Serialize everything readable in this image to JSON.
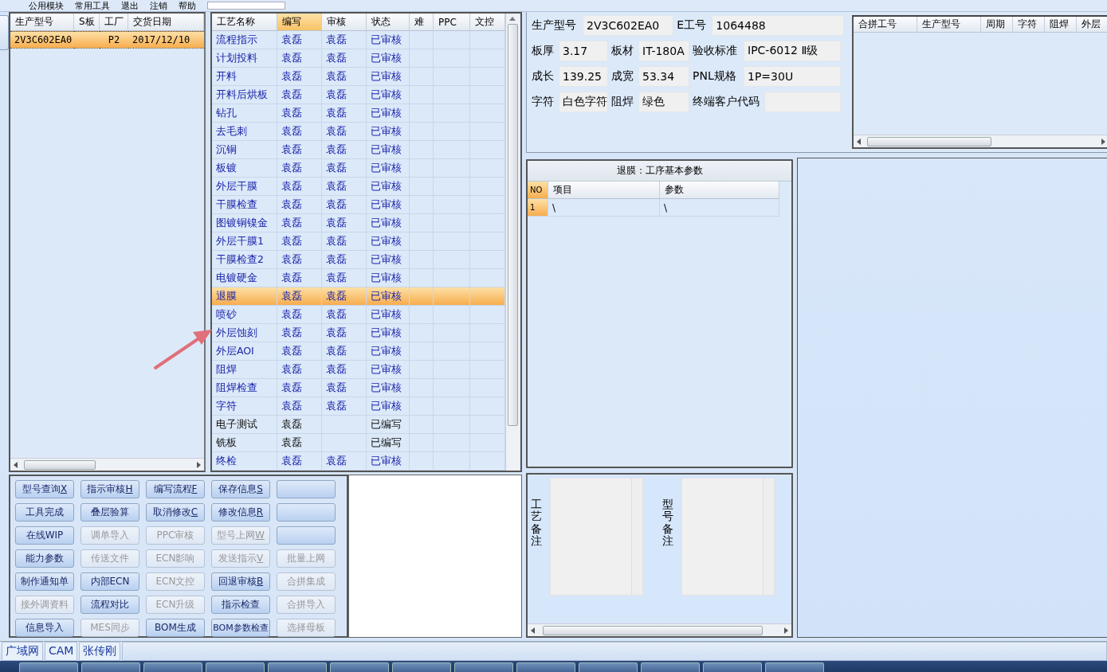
{
  "menu": [
    {
      "label": "公用模块"
    },
    {
      "label": "常用工具"
    },
    {
      "label": "退出"
    },
    {
      "label": "注销"
    },
    {
      "label": "帮助"
    }
  ],
  "order_grid": {
    "columns": [
      "生产型号",
      "S板",
      "工厂",
      "交货日期"
    ],
    "rows": [
      {
        "model": "2V3C602EA0",
        "factory": "P2",
        "date": "2017/12/10",
        "selected": true
      }
    ]
  },
  "process_grid": {
    "columns": [
      {
        "label": "工艺名称",
        "selected": false
      },
      {
        "label": "编写",
        "selected": true
      },
      {
        "label": "审核",
        "selected": false
      },
      {
        "label": "状态",
        "selected": false
      },
      {
        "label": "难",
        "selected": false
      },
      {
        "label": "PPC",
        "selected": false
      },
      {
        "label": "文控",
        "selected": false
      }
    ],
    "rows": [
      {
        "name": "流程指示",
        "author": "袁磊",
        "reviewer": "袁磊",
        "status": "已审核",
        "reviewed": true,
        "selected": false
      },
      {
        "name": "计划投料",
        "author": "袁磊",
        "reviewer": "袁磊",
        "status": "已审核",
        "reviewed": true,
        "selected": false
      },
      {
        "name": "开料",
        "author": "袁磊",
        "reviewer": "袁磊",
        "status": "已审核",
        "reviewed": true,
        "selected": false
      },
      {
        "name": "开料后烘板",
        "author": "袁磊",
        "reviewer": "袁磊",
        "status": "已审核",
        "reviewed": true,
        "selected": false
      },
      {
        "name": "钻孔",
        "author": "袁磊",
        "reviewer": "袁磊",
        "status": "已审核",
        "reviewed": true,
        "selected": false
      },
      {
        "name": "去毛刺",
        "author": "袁磊",
        "reviewer": "袁磊",
        "status": "已审核",
        "reviewed": true,
        "selected": false
      },
      {
        "name": "沉铜",
        "author": "袁磊",
        "reviewer": "袁磊",
        "status": "已审核",
        "reviewed": true,
        "selected": false
      },
      {
        "name": "板镀",
        "author": "袁磊",
        "reviewer": "袁磊",
        "status": "已审核",
        "reviewed": true,
        "selected": false
      },
      {
        "name": "外层干膜",
        "author": "袁磊",
        "reviewer": "袁磊",
        "status": "已审核",
        "reviewed": true,
        "selected": false
      },
      {
        "name": "干膜检查",
        "author": "袁磊",
        "reviewer": "袁磊",
        "status": "已审核",
        "reviewed": true,
        "selected": false
      },
      {
        "name": "图镀铜镍金",
        "author": "袁磊",
        "reviewer": "袁磊",
        "status": "已审核",
        "reviewed": true,
        "selected": false
      },
      {
        "name": "外层干膜1",
        "author": "袁磊",
        "reviewer": "袁磊",
        "status": "已审核",
        "reviewed": true,
        "selected": false
      },
      {
        "name": "干膜检查2",
        "author": "袁磊",
        "reviewer": "袁磊",
        "status": "已审核",
        "reviewed": true,
        "selected": false
      },
      {
        "name": "电镀硬金",
        "author": "袁磊",
        "reviewer": "袁磊",
        "status": "已审核",
        "reviewed": true,
        "selected": false
      },
      {
        "name": "退膜",
        "author": "袁磊",
        "reviewer": "袁磊",
        "status": "已审核",
        "reviewed": true,
        "selected": true
      },
      {
        "name": "喷砂",
        "author": "袁磊",
        "reviewer": "袁磊",
        "status": "已审核",
        "reviewed": true,
        "selected": false
      },
      {
        "name": "外层蚀刻",
        "author": "袁磊",
        "reviewer": "袁磊",
        "status": "已审核",
        "reviewed": true,
        "selected": false
      },
      {
        "name": "外层AOI",
        "author": "袁磊",
        "reviewer": "袁磊",
        "status": "已审核",
        "reviewed": true,
        "selected": false
      },
      {
        "name": "阻焊",
        "author": "袁磊",
        "reviewer": "袁磊",
        "status": "已审核",
        "reviewed": true,
        "selected": false
      },
      {
        "name": "阻焊检查",
        "author": "袁磊",
        "reviewer": "袁磊",
        "status": "已审核",
        "reviewed": true,
        "selected": false
      },
      {
        "name": "字符",
        "author": "袁磊",
        "reviewer": "袁磊",
        "status": "已审核",
        "reviewed": true,
        "selected": false
      },
      {
        "name": "电子测试",
        "author": "袁磊",
        "status": "已编写",
        "reviewed": false,
        "selected": false
      },
      {
        "name": "铣板",
        "author": "袁磊",
        "status": "已编写",
        "reviewed": false,
        "selected": false
      },
      {
        "name": "终检",
        "author": "袁磊",
        "reviewer": "袁磊",
        "status": "已审核",
        "reviewed": true,
        "selected": false
      }
    ]
  },
  "buttons": [
    [
      {
        "label": "型号查询",
        "mnemonic": "X",
        "disabled": false
      },
      {
        "label": "指示审核",
        "mnemonic": "H",
        "disabled": false
      },
      {
        "label": "编写流程",
        "mnemonic": "F",
        "disabled": false
      },
      {
        "label": "保存信息",
        "mnemonic": "S",
        "disabled": false
      },
      {
        "disabled": false
      }
    ],
    [
      {
        "label": "工具完成",
        "disabled": false
      },
      {
        "label": "叠层验算",
        "disabled": false
      },
      {
        "label": "取消修改",
        "mnemonic": "C",
        "disabled": false
      },
      {
        "label": "修改信息",
        "mnemonic": "R",
        "disabled": false
      },
      {
        "disabled": false
      }
    ],
    [
      {
        "label": "在线WIP",
        "disabled": false
      },
      {
        "label": "调单导入",
        "disabled": true
      },
      {
        "label": "PPC审核",
        "disabled": true
      },
      {
        "label": "型号上网",
        "mnemonic": "W",
        "disabled": true
      },
      {
        "disabled": false
      }
    ],
    [
      {
        "label": "能力参数",
        "disabled": false
      },
      {
        "label": "传送文件",
        "disabled": true
      },
      {
        "label": "ECN影响",
        "disabled": true
      },
      {
        "label": "发送指示",
        "mnemonic": "V",
        "disabled": true
      },
      {
        "label": "批量上网",
        "disabled": true
      }
    ],
    [
      {
        "label": "制作通知单",
        "disabled": false
      },
      {
        "label": "内部ECN",
        "disabled": false
      },
      {
        "label": "ECN文控",
        "disabled": true
      },
      {
        "label": "回退审核",
        "mnemonic": "B",
        "disabled": false
      },
      {
        "label": "合拼集成",
        "disabled": true
      }
    ],
    [
      {
        "label": "接外调资料",
        "disabled": true
      },
      {
        "label": "流程对比",
        "disabled": false
      },
      {
        "label": "ECN升级",
        "disabled": true
      },
      {
        "label": "指示检查",
        "disabled": false
      },
      {
        "label": "合拼导入",
        "disabled": true
      }
    ],
    [
      {
        "label": "信息导入",
        "disabled": false
      },
      {
        "label": "MES同步",
        "disabled": true
      },
      {
        "label": "BOM生成",
        "disabled": false
      },
      {
        "label": "BOM参数检查",
        "disabled": false
      },
      {
        "label": "选择母板",
        "disabled": true
      }
    ]
  ],
  "info": {
    "fields": [
      {
        "label": "生产型号",
        "value": "2V3C602EA0"
      },
      {
        "label": "E工号",
        "value": "1064488"
      },
      {
        "label": "板厚",
        "value": "3.17"
      },
      {
        "label": "板材",
        "value": "IT-180A"
      },
      {
        "label": "验收标准",
        "value": "IPC-6012 Ⅱ级"
      },
      {
        "label": "成长",
        "value": "139.25"
      },
      {
        "label": "成宽",
        "value": "53.34"
      },
      {
        "label": "PNL规格",
        "value": "1P=30U"
      },
      {
        "label": "字符",
        "value": "白色字符"
      },
      {
        "label": "阻焊",
        "value": "绿色"
      },
      {
        "label": "终端客户代码"
      }
    ]
  },
  "merge_grid": {
    "columns": [
      "合拼工号",
      "生产型号",
      "周期",
      "字符",
      "阻焊",
      "外层"
    ]
  },
  "params": {
    "title": "退膜：工序基本参数",
    "columns": [
      "NO",
      "项目",
      "参数"
    ],
    "rows": [
      {
        "no": "1",
        "item": "\\",
        "param": "\\"
      }
    ]
  },
  "remarks": [
    {
      "label": "工艺备注"
    },
    {
      "label": "型号备注"
    }
  ],
  "status_bar": [
    "广域网",
    "CAM",
    "张传刚"
  ]
}
